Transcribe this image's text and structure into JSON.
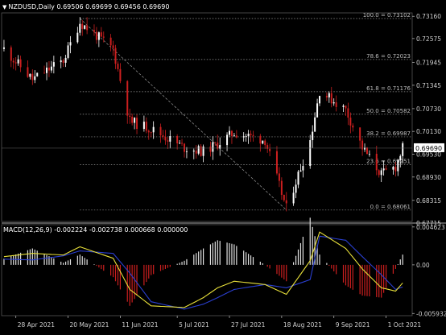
{
  "main_pane": {
    "title_symbol": "NZDUSD,Daily",
    "ohlc": "0.69506 0.69699 0.69456 0.69690"
  },
  "macd_pane": {
    "title": "MACD(12,26,9) -0.002224 -0.002738 0.000668 0.000000"
  },
  "colors": {
    "background": "#000000",
    "bull_candle": "#ffffff",
    "bear_candle": "#cc1f1f",
    "fibo": "#9a9a9a",
    "macd_histogram_positive": "#e0e0e0",
    "macd_histogram_negative": "#cc1f1f",
    "macd_line": "#2a3fd0",
    "signal_line": "#e8e03a",
    "price_tag": "#ffffff"
  },
  "chart_data": [
    {
      "type": "candlestick",
      "title": "NZDUSD,Daily",
      "ylim": [
        0.6776,
        0.7325
      ],
      "yticks": [
        "0.73160",
        "0.72575",
        "0.71945",
        "0.71345",
        "0.70730",
        "0.70130",
        "0.69530",
        "0.68930",
        "0.68315",
        "0.67715"
      ],
      "xticks": [
        "28 Apr 2021",
        "20 May 2021",
        "11 Jun 2021",
        "5 Jul 2021",
        "27 Jul 2021",
        "18 Aug 2021",
        "9 Sep 2021",
        "1 Oct 2021"
      ],
      "current_price": "0.69690",
      "fibonacci_levels": [
        {
          "label": "100.0 = 0.73102",
          "value": 0.73102
        },
        {
          "label": "78.6 = 0.72023",
          "value": 0.72023
        },
        {
          "label": "61.8 = 0.71176",
          "value": 0.71176
        },
        {
          "label": "50.0 = 0.70582",
          "value": 0.70582
        },
        {
          "label": "38.2 = 0.69987",
          "value": 0.69987
        },
        {
          "label": "23.6 = 0.69251",
          "value": 0.69251
        },
        {
          "label": "0.0 = 0.68061",
          "value": 0.68061
        }
      ],
      "trendline": {
        "from": {
          "date": "25 May 2021",
          "price": 0.73102
        },
        "to": {
          "date": "20 Aug 2021",
          "price": 0.68061
        }
      },
      "close_series": {
        "dates": [
          "23 Apr 2021",
          "5 May 2021",
          "18 May 2021",
          "25 May 2021",
          "8 Jun 2021",
          "15 Jun 2021",
          "24 Jun 2021",
          "8 Jul 2021",
          "16 Jul 2021",
          "22 Jul 2021",
          "29 Jul 2021",
          "11 Aug 2021",
          "20 Aug 2021",
          "30 Aug 2021",
          "3 Sep 2021",
          "14 Sep 2021",
          "21 Sep 2021",
          "29 Sep 2021",
          "5 Oct 2021",
          "8 Oct 2021"
        ],
        "values": [
          0.723,
          0.715,
          0.72,
          0.73,
          0.723,
          0.704,
          0.702,
          0.697,
          0.696,
          0.698,
          0.701,
          0.699,
          0.681,
          0.699,
          0.712,
          0.707,
          0.697,
          0.69,
          0.692,
          0.6969
        ]
      }
    },
    {
      "type": "macd",
      "title": "MACD(12,26,9)",
      "values_shown": {
        "macd": -0.002224,
        "signal": -0.002738,
        "histogram": 0.000668,
        "zero": 0.0
      },
      "ylim": [
        -0.0062,
        0.0049
      ],
      "yticks": [
        "0.004623",
        "0.00",
        "-0.005932"
      ],
      "series": [
        {
          "name": "MACD",
          "values": [
            0.001,
            0.0014,
            0.0012,
            0.0022,
            0.0008,
            -0.003,
            -0.005,
            -0.0052,
            -0.004,
            -0.0028,
            -0.002,
            -0.0024,
            -0.0036,
            0.0005,
            0.004,
            0.002,
            -0.0005,
            -0.0028,
            -0.0032,
            -0.0022
          ]
        },
        {
          "name": "Signal",
          "values": [
            0.0007,
            0.0006,
            0.0011,
            0.0017,
            0.0014,
            -0.001,
            -0.0045,
            -0.0054,
            -0.0048,
            -0.004,
            -0.003,
            -0.0024,
            -0.0028,
            -0.0018,
            0.0035,
            0.003,
            0.001,
            -0.0012,
            -0.003,
            -0.0027
          ]
        }
      ]
    }
  ]
}
